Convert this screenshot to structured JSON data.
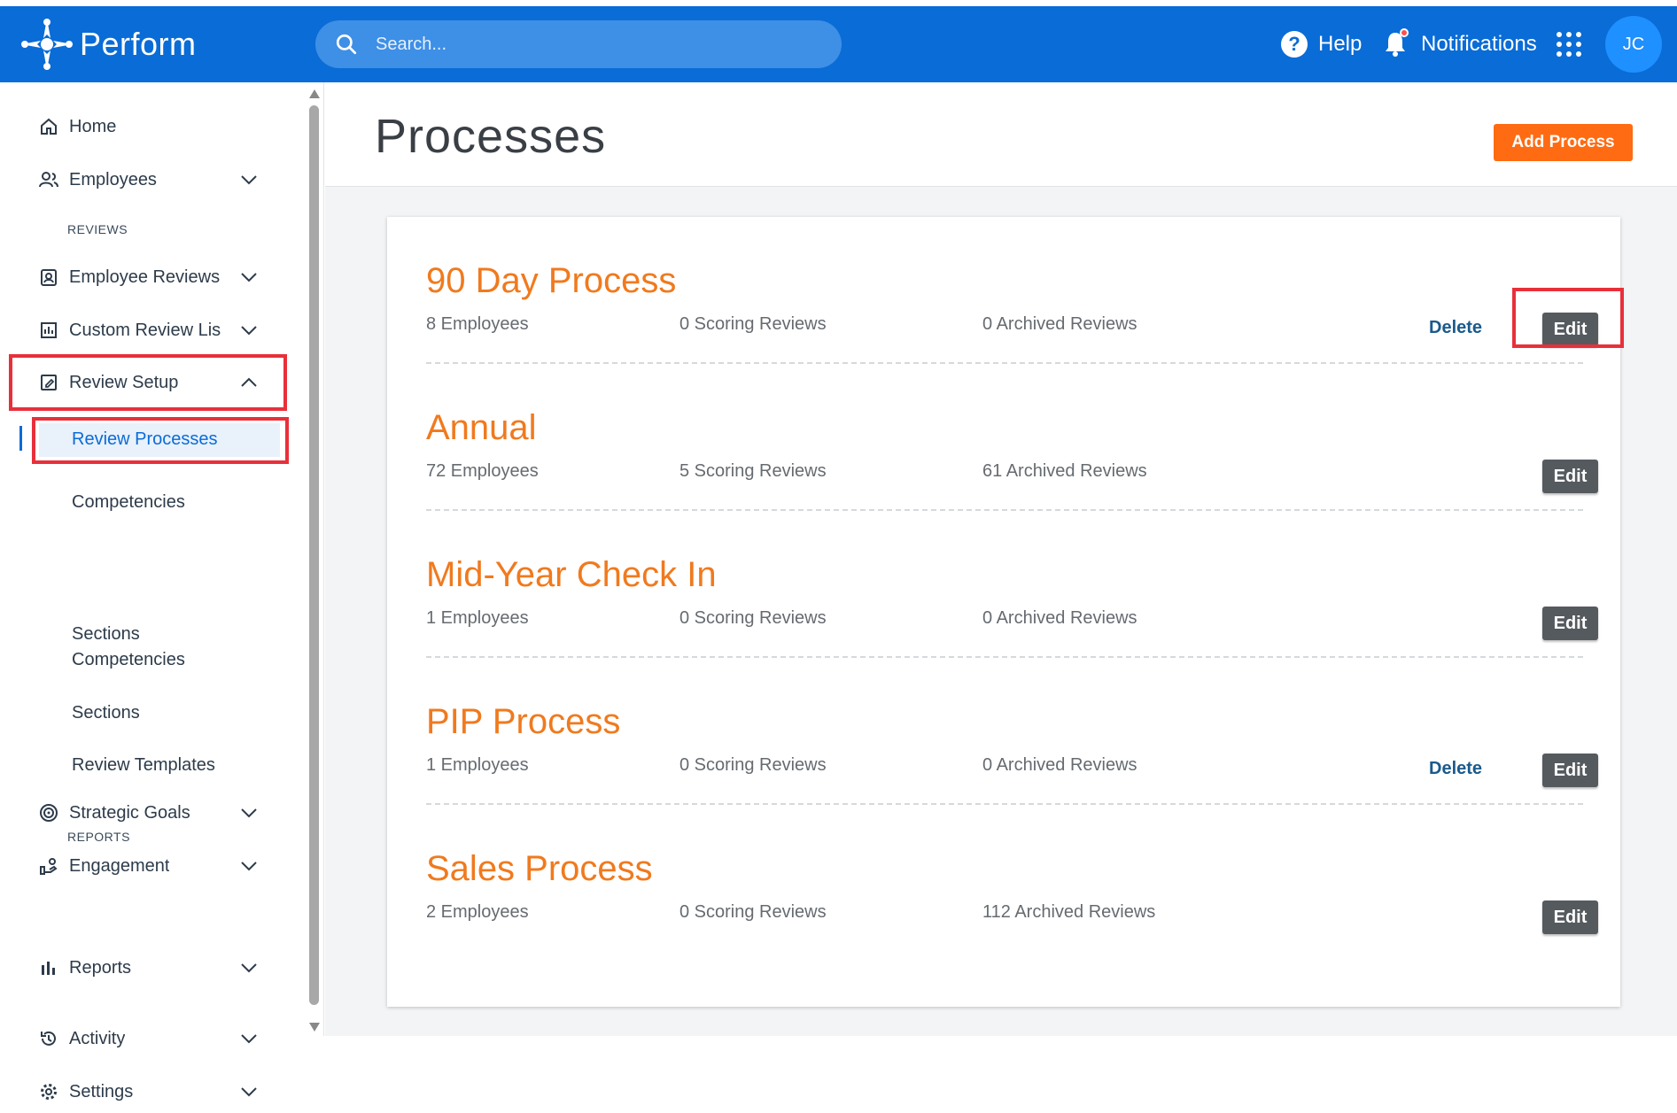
{
  "header": {
    "brand": "Perform",
    "search_placeholder": "Search...",
    "help_label": "Help",
    "notifications_label": "Notifications",
    "avatar_initials": "JC",
    "colors": {
      "bar": "#0a6cd6",
      "notification_dot": "#ff4d4d"
    }
  },
  "sidebar": {
    "home": "Home",
    "employees": "Employees",
    "reviews_section": "REVIEWS",
    "employee_reviews": "Employee Reviews",
    "custom_review_lists": "Custom Review Lis",
    "review_setup": "Review Setup",
    "review_processes": "Review Processes",
    "competencies_1": "Competencies",
    "sections_clipped": "Sections",
    "competencies_2": "Competencies",
    "sections": "Sections",
    "review_templates": "Review Templates",
    "strategic_goals": "Strategic Goals",
    "engagement": "Engagement",
    "reports_section": "REPORTS",
    "reports": "Reports",
    "activity": "Activity",
    "settings": "Settings"
  },
  "main": {
    "title": "Processes",
    "add_button": "Add Process",
    "delete_label": "Delete",
    "edit_label": "Edit",
    "accent_color": "#f07a1e",
    "processes": [
      {
        "name": "90 Day Process",
        "employees": "8 Employees",
        "scoring": "0 Scoring Reviews",
        "archived": "0 Archived Reviews",
        "has_delete": true
      },
      {
        "name": "Annual",
        "employees": "72 Employees",
        "scoring": "5 Scoring Reviews",
        "archived": "61 Archived Reviews",
        "has_delete": false
      },
      {
        "name": "Mid-Year Check In",
        "employees": "1 Employees",
        "scoring": "0 Scoring Reviews",
        "archived": "0 Archived Reviews",
        "has_delete": false
      },
      {
        "name": "PIP Process",
        "employees": "1 Employees",
        "scoring": "0 Scoring Reviews",
        "archived": "0 Archived Reviews",
        "has_delete": true
      },
      {
        "name": "Sales Process",
        "employees": "2 Employees",
        "scoring": "0 Scoring Reviews",
        "archived": "112 Archived Reviews",
        "has_delete": false
      }
    ]
  }
}
